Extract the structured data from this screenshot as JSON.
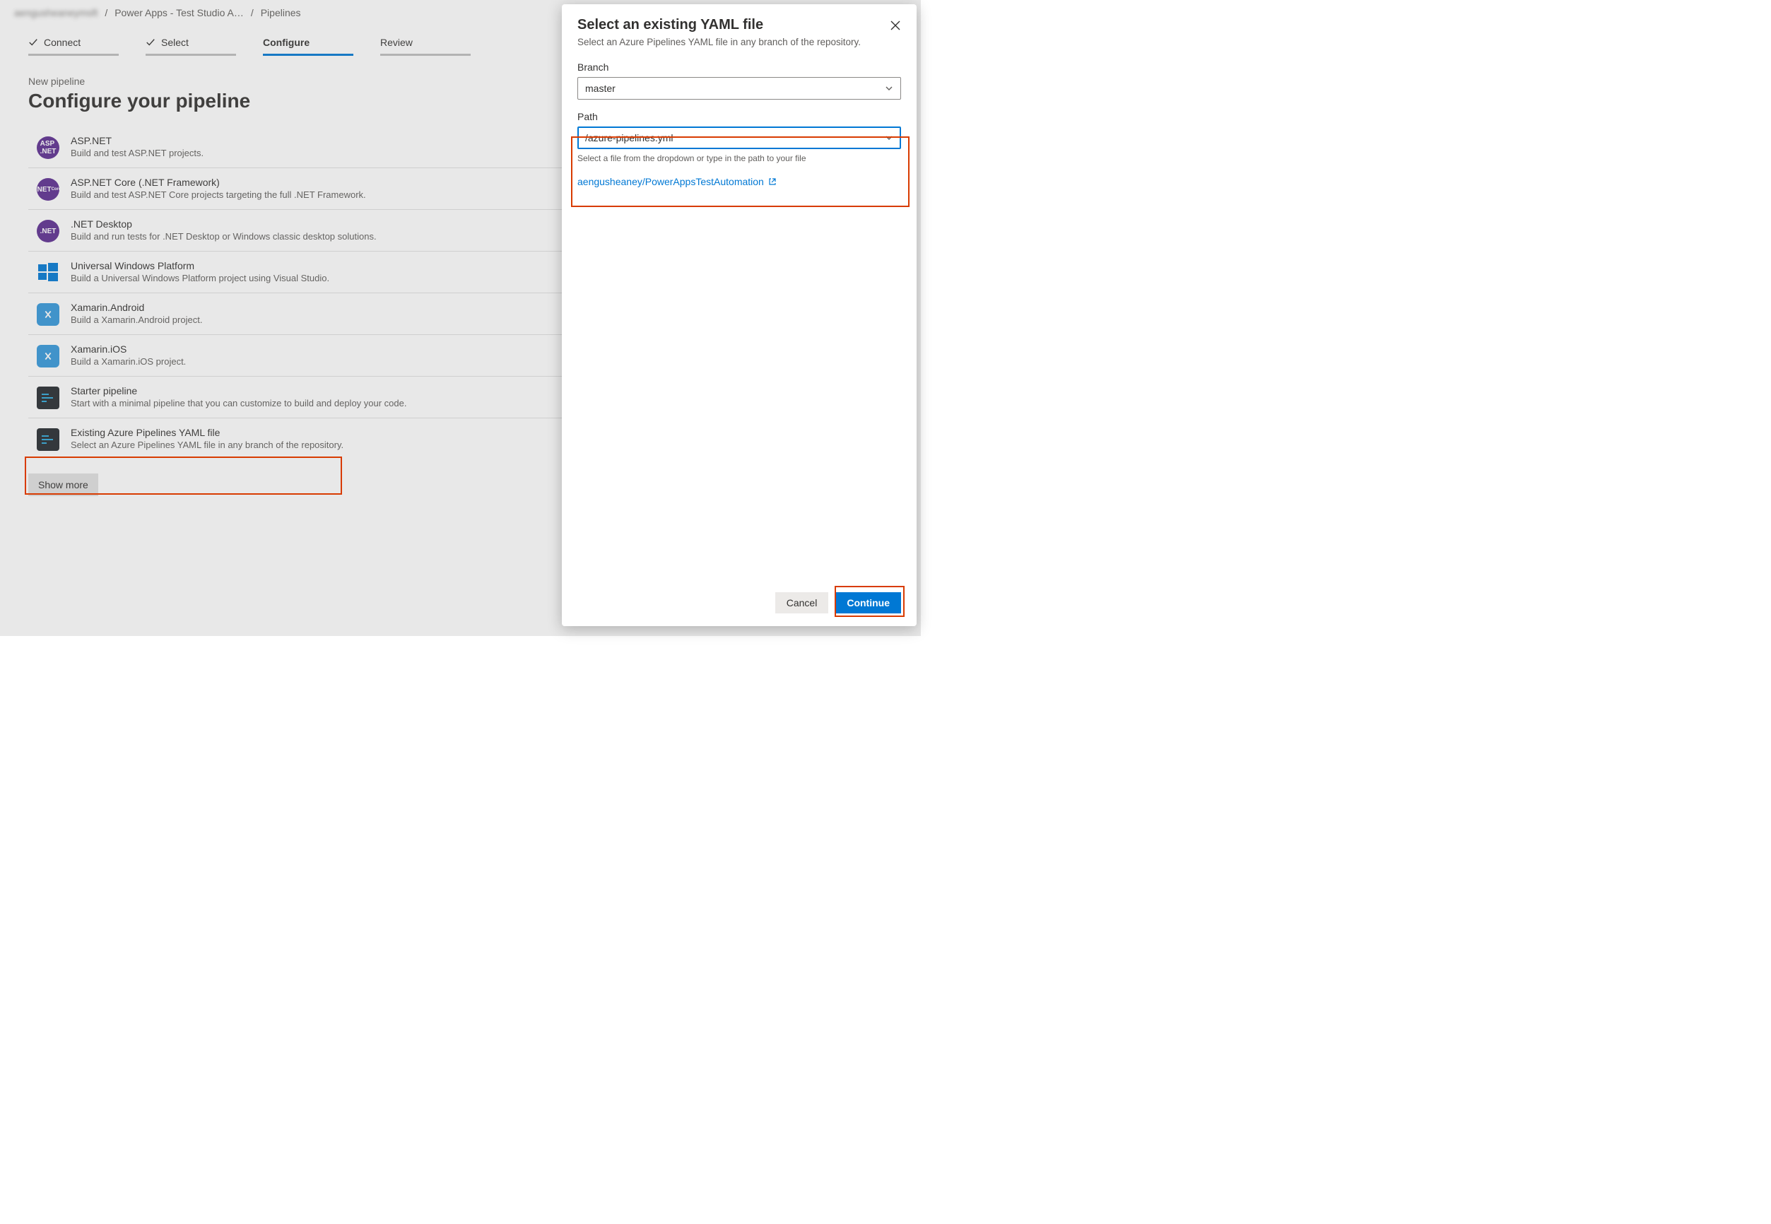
{
  "breadcrumb": {
    "org": "aengusheaneymsft",
    "project": "Power Apps - Test Studio A…",
    "page": "Pipelines"
  },
  "stepper": {
    "connect": "Connect",
    "select": "Select",
    "configure": "Configure",
    "review": "Review"
  },
  "heading": {
    "eyebrow": "New pipeline",
    "title": "Configure your pipeline"
  },
  "templates": [
    {
      "icon": "aspnet",
      "title": "ASP.NET",
      "desc": "Build and test ASP.NET projects."
    },
    {
      "icon": "aspnetcore",
      "title": "ASP.NET Core (.NET Framework)",
      "desc": "Build and test ASP.NET Core projects targeting the full .NET Framework."
    },
    {
      "icon": "netdesk",
      "title": ".NET Desktop",
      "desc": "Build and run tests for .NET Desktop or Windows classic desktop solutions."
    },
    {
      "icon": "uwp",
      "title": "Universal Windows Platform",
      "desc": "Build a Universal Windows Platform project using Visual Studio."
    },
    {
      "icon": "xam",
      "title": "Xamarin.Android",
      "desc": "Build a Xamarin.Android project."
    },
    {
      "icon": "xam",
      "title": "Xamarin.iOS",
      "desc": "Build a Xamarin.iOS project."
    },
    {
      "icon": "yaml",
      "title": "Starter pipeline",
      "desc": "Start with a minimal pipeline that you can customize to build and deploy your code."
    },
    {
      "icon": "yaml",
      "title": "Existing Azure Pipelines YAML file",
      "desc": "Select an Azure Pipelines YAML file in any branch of the repository."
    }
  ],
  "show_more": "Show more",
  "panel": {
    "title": "Select an existing YAML file",
    "subtitle": "Select an Azure Pipelines YAML file in any branch of the repository.",
    "branch_label": "Branch",
    "branch_value": "master",
    "path_label": "Path",
    "path_value": "/azure-pipelines.yml",
    "path_help": "Select a file from the dropdown or type in the path to your file",
    "repo_link": "aengusheaney/PowerAppsTestAutomation",
    "cancel": "Cancel",
    "continue": "Continue"
  }
}
